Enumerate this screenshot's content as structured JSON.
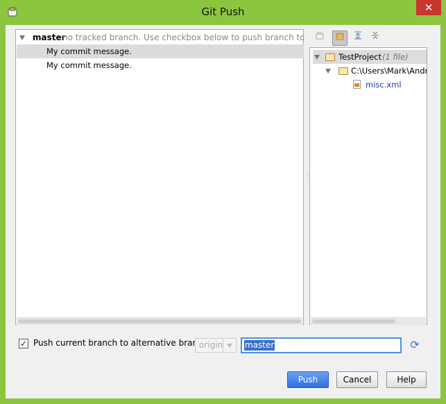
{
  "window": {
    "title": "Git Push",
    "close_glyph": "✕"
  },
  "commits_panel": {
    "branch": "master",
    "branch_note": "no tracked branch. Use checkbox below to push branch to manually",
    "commits": [
      {
        "message": "My commit message."
      },
      {
        "message": "My commit message."
      }
    ]
  },
  "files_toolbar": {
    "icons": [
      "group-by-directory-icon",
      "group-by-module-icon",
      "expand-all-icon",
      "collapse-all-icon"
    ]
  },
  "files_tree": {
    "project": "TestProject",
    "project_count": "(1 file)",
    "folder": "C:\\Users\\Mark\\Andro",
    "file": "misc.xml"
  },
  "push_options": {
    "checkbox_checked": true,
    "checkbox_label": "Push current branch to alternative branch:",
    "remote_value": "origin",
    "branch_value": "master"
  },
  "buttons": {
    "push": "Push",
    "cancel": "Cancel",
    "help": "Help"
  },
  "colors": {
    "frame": "#8cc63f",
    "accent": "#2f6fd9",
    "selection": "#dcdcdc"
  }
}
